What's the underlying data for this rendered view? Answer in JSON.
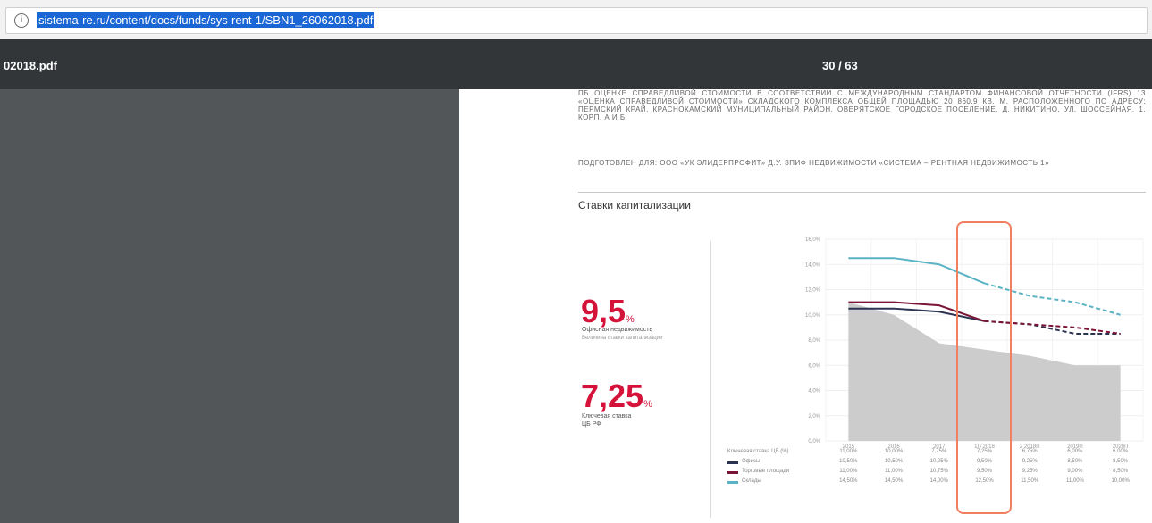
{
  "browser": {
    "url": "sistema-re.ru/content/docs/funds/sys-rent-1/SBN1_26062018.pdf",
    "info_icon": "info-icon"
  },
  "pdf_toolbar": {
    "file_name": "02018.pdf",
    "page_indicator": "30 / 63"
  },
  "document": {
    "header": "ПБ ОЦЕНКЕ СПРАВЕДЛИВОЙ СТОИМОСТИ В СООТВЕТСТВИИ С МЕЖДУНАРОДНЫМ СТАНДАРТОМ ФИНАНСОВОЙ ОТЧЕТНОСТИ (IFRS) 13 «ОЦЕНКА СПРАВЕДЛИВОЙ СТОИМОСТИ» СКЛАДСКОГО КОМПЛЕКСА ОБЩЕЙ ПЛОЩАДЬЮ 20 860,9 КВ. М, РАСПОЛОЖЕННОГО ПО АДРЕСУ: ПЕРМСКИЙ КРАЙ, КРАСНОКАМСКИЙ МУНИЦИПАЛЬНЫЙ РАЙОН, ОВЕРЯТСКОЕ ГОРОДСКОЕ ПОСЕЛЕНИЕ, Д. НИКИТИНО, УЛ. ШОССЕЙНАЯ, 1, КОРП. А И Б",
    "prepared_for": "ПОДГОТОВЛЕН ДЛЯ: ООО «УК ЭЛИДЕРПРОФИТ» Д.У. ЗПИФ НЕДВИЖИМОСТИ «СИСТЕМА – РЕНТНАЯ НЕДВИЖИМОСТЬ 1»",
    "chart_title": "Ставки капитализации",
    "stat1": {
      "value": "9,5",
      "unit": "%",
      "label": "Офисная недвижимость",
      "sublabel": "Величина ставки капитализации"
    },
    "stat2": {
      "value": "7,25",
      "unit": "%",
      "label": "Ключевая ставка",
      "sublabel": "ЦБ РФ"
    }
  },
  "chart_data": {
    "type": "line",
    "x": [
      "2015",
      "2016",
      "2017",
      "1П 2018",
      "2 2018П",
      "2019П",
      "2020П"
    ],
    "ylim": [
      0,
      16
    ],
    "y_ticks": [
      "0,0%",
      "2,0%",
      "4,0%",
      "6,0%",
      "8,0%",
      "10,0%",
      "12,0%",
      "14,0%",
      "16,0%"
    ],
    "series": [
      {
        "name": "Ключевая ставка ЦБ",
        "kind": "area",
        "color": "#cccccc",
        "values": [
          11.0,
          10.0,
          7.75,
          7.25,
          6.75,
          6.0,
          6.0
        ]
      },
      {
        "name": "Офисы",
        "color": "#2b3350",
        "values": [
          10.5,
          10.5,
          10.25,
          9.5,
          9.25,
          8.5,
          8.5
        ],
        "projected_from": 3
      },
      {
        "name": "Торговые площади",
        "color": "#7b1535",
        "values": [
          11.0,
          11.0,
          10.75,
          9.5,
          9.25,
          9.0,
          8.5
        ],
        "projected_from": 3
      },
      {
        "name": "Склады",
        "color": "#5ab3c4",
        "values": [
          14.5,
          14.5,
          14.0,
          12.5,
          11.5,
          11.0,
          10.0
        ],
        "projected_from": 3
      }
    ],
    "table": {
      "headers": [
        "2015",
        "2016",
        "2017",
        "1П 2018",
        "2 2018П",
        "2019П",
        "2020П"
      ],
      "rows": [
        {
          "label": "Ключевая ставка ЦБ (%)",
          "values": [
            "11,00%",
            "10,00%",
            "7,75%",
            "7,25%",
            "6,75%",
            "6,00%",
            "6,00%"
          ]
        },
        {
          "label": "Офисы",
          "values": [
            "10,50%",
            "10,50%",
            "10,25%",
            "9,50%",
            "9,25%",
            "8,50%",
            "8,50%"
          ]
        },
        {
          "label": "Торговые площади",
          "values": [
            "11,00%",
            "11,00%",
            "10,75%",
            "9,50%",
            "9,25%",
            "9,00%",
            "8,50%"
          ]
        },
        {
          "label": "Склады",
          "values": [
            "14,50%",
            "14,50%",
            "14,00%",
            "12,50%",
            "11,50%",
            "11,00%",
            "10,00%"
          ]
        }
      ]
    }
  }
}
